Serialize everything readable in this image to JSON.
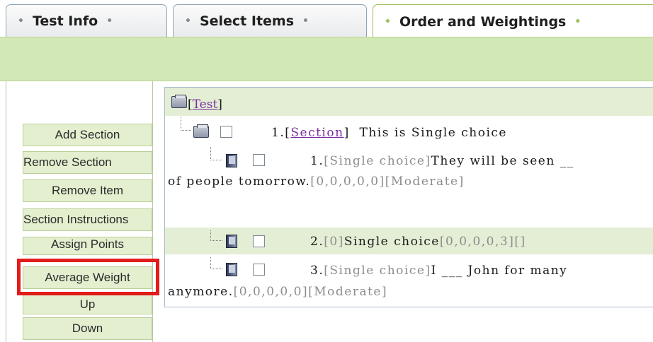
{
  "tabs": [
    {
      "label": "Test Info",
      "active": false
    },
    {
      "label": "Select Items",
      "active": false
    },
    {
      "label": "Order and Weightings",
      "active": true
    }
  ],
  "actions": [
    "Add Section",
    "Remove Section",
    "Remove Item",
    "Section Instructions",
    "Assign Points",
    "Average Weight",
    "Up",
    "Down"
  ],
  "highlighted_action": "Average Weight",
  "tree": {
    "root": "Test",
    "section": {
      "number": "1.",
      "type": "Section",
      "title": "This is Single choice"
    },
    "items": [
      {
        "number": "1.",
        "type": "[Single choice]",
        "text1": "They will be seen __",
        "text2": "of people tomorrow.",
        "meta": "[0,0,0,0,0][Moderate]"
      },
      {
        "number": "2.",
        "type": "[0]",
        "text1": "Single choice",
        "meta": "[0,0,0,0,3][]"
      },
      {
        "number": "3.",
        "type": "[Single choice]",
        "text1": "I ___ John for many",
        "text2": "anymore.",
        "meta": "[0,0,0,0,0][Moderate]"
      }
    ]
  },
  "colors": {
    "accent_green": "#d3e8b7",
    "highlight_red": "#e21b1b",
    "link_purple": "#7a2fa0"
  }
}
